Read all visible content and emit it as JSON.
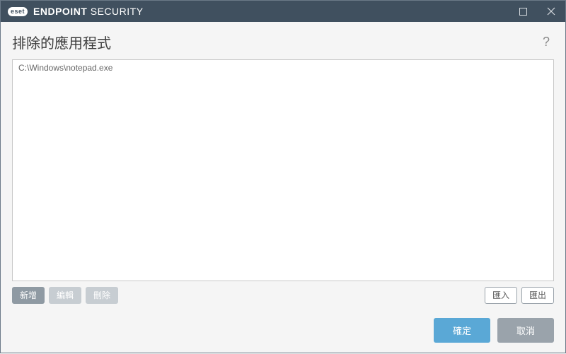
{
  "titlebar": {
    "brand_badge": "eset",
    "brand_text_bold": "ENDPOINT",
    "brand_text_light": "SECURITY"
  },
  "page": {
    "heading": "排除的應用程式"
  },
  "list": {
    "items": [
      {
        "path": "C:\\Windows\\notepad.exe"
      }
    ]
  },
  "toolbar": {
    "add": "新增",
    "edit": "編輯",
    "delete": "刪除",
    "import": "匯入",
    "export": "匯出"
  },
  "footer": {
    "ok": "確定",
    "cancel": "取消"
  }
}
